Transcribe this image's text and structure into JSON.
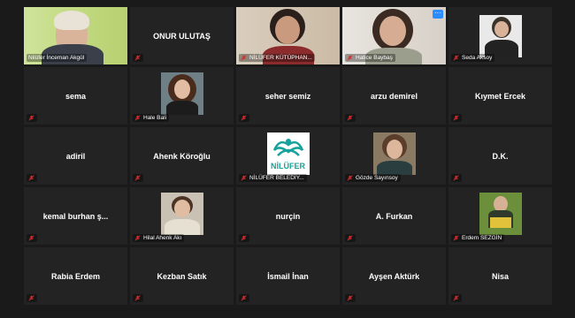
{
  "participants": [
    {
      "name": "Nilüfer İnceman Akgül"
    },
    {
      "name": "ONUR ULUTAŞ"
    },
    {
      "name": "NİLÜFER KÜTÜPHAN..."
    },
    {
      "name": "Hatice Baybaş"
    },
    {
      "name": "Seda Aksoy"
    },
    {
      "name": "sema"
    },
    {
      "name": "Hale Bali"
    },
    {
      "name": "seher semiz"
    },
    {
      "name": "arzu demirel"
    },
    {
      "name": "Kıymet Ercek"
    },
    {
      "name": "adiril"
    },
    {
      "name": "Ahenk Köroğlu"
    },
    {
      "name": "NİLÜFER BELEDİY..."
    },
    {
      "name": "Gözde Sayınsoy"
    },
    {
      "name": "D.K."
    },
    {
      "name": "kemal burhan ş..."
    },
    {
      "name": "Hilal Ahenk Akı"
    },
    {
      "name": "nurçin"
    },
    {
      "name": "A. Furkan"
    },
    {
      "name": "Erdem SEZGİN"
    },
    {
      "name": "Rabia Erdem"
    },
    {
      "name": "Kezban Satık"
    },
    {
      "name": "İsmail İnan"
    },
    {
      "name": "Ayşen Aktürk"
    },
    {
      "name": "Nisa"
    }
  ],
  "logo_text": "NİLÜFER",
  "more_button": "···",
  "colors": {
    "background": "#1a1a1a",
    "tile": "#232323",
    "active_speaker": "#b5e34c",
    "muted_icon": "#e02828",
    "more_button": "#2d8cff"
  },
  "icons": {
    "muted": "muted-mic-icon"
  }
}
